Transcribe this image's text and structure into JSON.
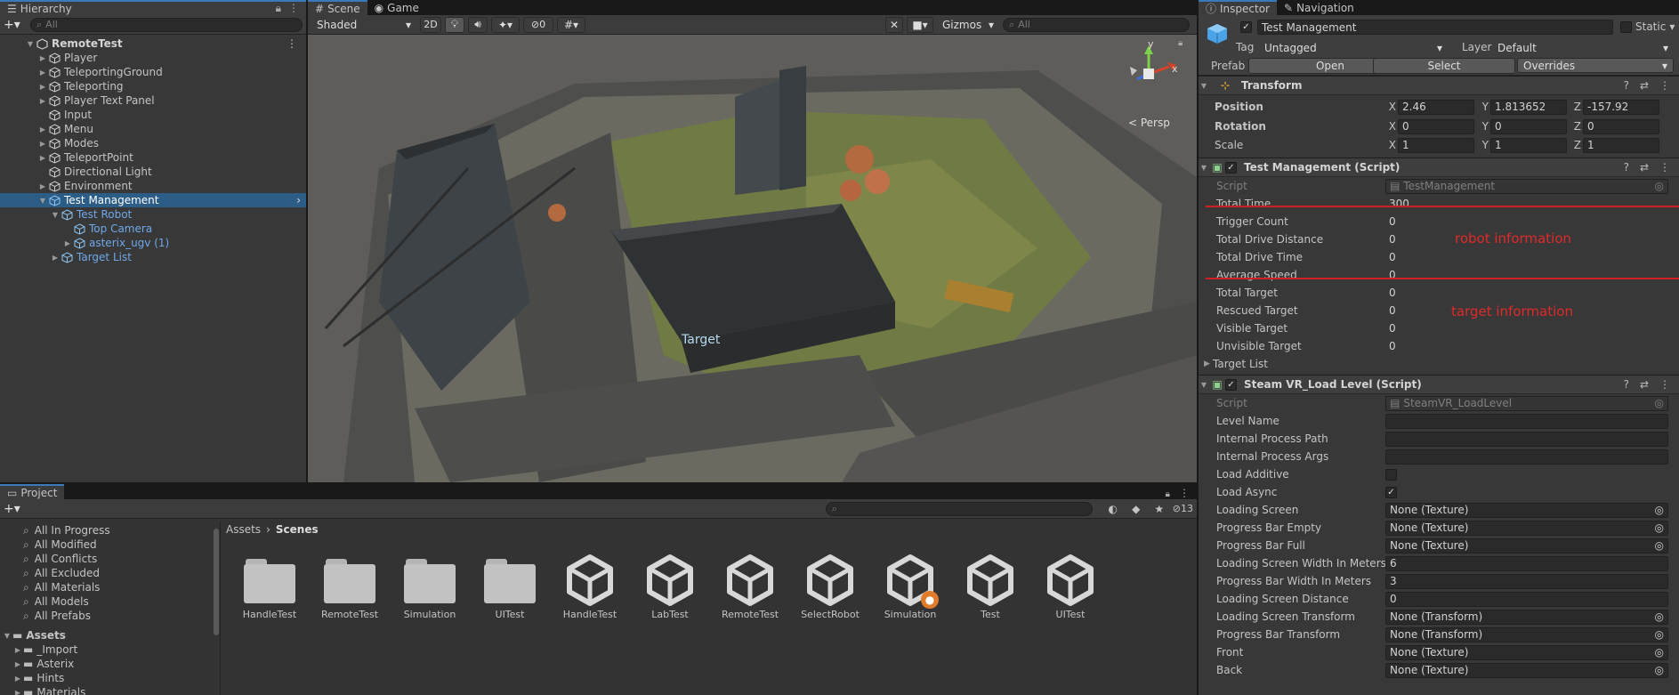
{
  "hierarchy": {
    "tab": "Hierarchy",
    "search_placeholder": "All",
    "root": "RemoteTest",
    "items": [
      {
        "label": "Player",
        "depth": 1,
        "arrow": true,
        "blue": false
      },
      {
        "label": "TeleportingGround",
        "depth": 1,
        "arrow": true,
        "blue": false
      },
      {
        "label": "Teleporting",
        "depth": 1,
        "arrow": true,
        "blue": false
      },
      {
        "label": "Player Text Panel",
        "depth": 1,
        "arrow": true,
        "blue": false
      },
      {
        "label": "Input",
        "depth": 1,
        "arrow": false,
        "blue": false
      },
      {
        "label": "Menu",
        "depth": 1,
        "arrow": true,
        "blue": false
      },
      {
        "label": "Modes",
        "depth": 1,
        "arrow": true,
        "blue": false
      },
      {
        "label": "TeleportPoint",
        "depth": 1,
        "arrow": true,
        "blue": false
      },
      {
        "label": "Directional Light",
        "depth": 1,
        "arrow": false,
        "blue": false
      },
      {
        "label": "Environment",
        "depth": 1,
        "arrow": true,
        "blue": false
      },
      {
        "label": "Test Management",
        "depth": 1,
        "arrow": true,
        "blue": false,
        "selected": true
      },
      {
        "label": "Test Robot",
        "depth": 2,
        "arrow": true,
        "blue": true
      },
      {
        "label": "Top Camera",
        "depth": 3,
        "arrow": false,
        "blue": true
      },
      {
        "label": "asterix_ugv (1)",
        "depth": 3,
        "arrow": true,
        "blue": true
      },
      {
        "label": "Target List",
        "depth": 2,
        "arrow": true,
        "blue": true
      }
    ]
  },
  "scene": {
    "tabs": [
      "Scene",
      "Game"
    ],
    "shading": "Shaded",
    "mode_2d": "2D",
    "hidden_count": "0",
    "gizmos": "Gizmos",
    "search_placeholder": "All",
    "persp": "< Persp",
    "target_label": "Target",
    "axis_y": "y",
    "axis_x": "x"
  },
  "project": {
    "tab": "Project",
    "favorites": [
      "All In Progress",
      "All Modified",
      "All Conflicts",
      "All Excluded",
      "All Materials",
      "All Models",
      "All Prefabs"
    ],
    "assets_root": "Assets",
    "asset_folders": [
      "_Import",
      "Asterix",
      "Hints",
      "Materials"
    ],
    "breadcrumb": [
      "Assets",
      "Scenes"
    ],
    "hidden_count": "13",
    "files": [
      {
        "name": "HandleTest",
        "kind": "folder"
      },
      {
        "name": "RemoteTest",
        "kind": "folder"
      },
      {
        "name": "Simulation",
        "kind": "folder"
      },
      {
        "name": "UITest",
        "kind": "folder"
      },
      {
        "name": "HandleTest",
        "kind": "scene"
      },
      {
        "name": "LabTest",
        "kind": "scene"
      },
      {
        "name": "RemoteTest",
        "kind": "scene"
      },
      {
        "name": "SelectRobot",
        "kind": "scene"
      },
      {
        "name": "Simulation",
        "kind": "scene",
        "badge": true
      },
      {
        "name": "Test",
        "kind": "scene"
      },
      {
        "name": "UITest",
        "kind": "scene"
      }
    ]
  },
  "inspector": {
    "tabs": [
      "Inspector",
      "Navigation"
    ],
    "object_name": "Test Management",
    "static_label": "Static",
    "tag_label": "Tag",
    "tag_value": "Untagged",
    "layer_label": "Layer",
    "layer_value": "Default",
    "prefab_label": "Prefab",
    "prefab_open": "Open",
    "prefab_select": "Select",
    "prefab_overrides": "Overrides",
    "transform": {
      "title": "Transform",
      "position": {
        "label": "Position",
        "x": "2.46",
        "y": "1.813652",
        "z": "-157.92"
      },
      "rotation": {
        "label": "Rotation",
        "x": "0",
        "y": "0",
        "z": "0"
      },
      "scale": {
        "label": "Scale",
        "x": "1",
        "y": "1",
        "z": "1"
      }
    },
    "test_mgmt": {
      "title": "Test Management (Script)",
      "script_label": "Script",
      "script_value": "TestManagement",
      "fields": [
        {
          "label": "Total Time",
          "value": "300"
        },
        {
          "label": "Trigger Count",
          "value": "0"
        },
        {
          "label": "Total Drive Distance",
          "value": "0"
        },
        {
          "label": "Total Drive Time",
          "value": "0"
        },
        {
          "label": "Average Speed",
          "value": "0"
        },
        {
          "label": "Total Target",
          "value": "0"
        },
        {
          "label": "Rescued Target",
          "value": "0"
        },
        {
          "label": "Visible Target",
          "value": "0"
        },
        {
          "label": "Unvisible Target",
          "value": "0"
        }
      ],
      "target_list": "Target List",
      "annotation_robot": "robot information",
      "annotation_target": "target information"
    },
    "steamvr": {
      "title": "Steam VR_Load Level (Script)",
      "script_label": "Script",
      "script_value": "SteamVR_LoadLevel",
      "fields": [
        {
          "label": "Level Name",
          "value": "",
          "type": "text"
        },
        {
          "label": "Internal Process Path",
          "value": "",
          "type": "text"
        },
        {
          "label": "Internal Process Args",
          "value": "",
          "type": "text"
        },
        {
          "label": "Load Additive",
          "value": "",
          "type": "check"
        },
        {
          "label": "Load Async",
          "value": "✓",
          "type": "check"
        },
        {
          "label": "Loading Screen",
          "value": "None (Texture)",
          "type": "obj"
        },
        {
          "label": "Progress Bar Empty",
          "value": "None (Texture)",
          "type": "obj"
        },
        {
          "label": "Progress Bar Full",
          "value": "None (Texture)",
          "type": "obj"
        },
        {
          "label": "Loading Screen Width In Meters",
          "value": "6",
          "type": "text"
        },
        {
          "label": "Progress Bar Width In Meters",
          "value": "3",
          "type": "text"
        },
        {
          "label": "Loading Screen Distance",
          "value": "0",
          "type": "text"
        },
        {
          "label": "Loading Screen Transform",
          "value": "None (Transform)",
          "type": "obj"
        },
        {
          "label": "Progress Bar Transform",
          "value": "None (Transform)",
          "type": "obj"
        },
        {
          "label": "Front",
          "value": "None (Texture)",
          "type": "obj"
        },
        {
          "label": "Back",
          "value": "None (Texture)",
          "type": "obj"
        }
      ]
    }
  }
}
